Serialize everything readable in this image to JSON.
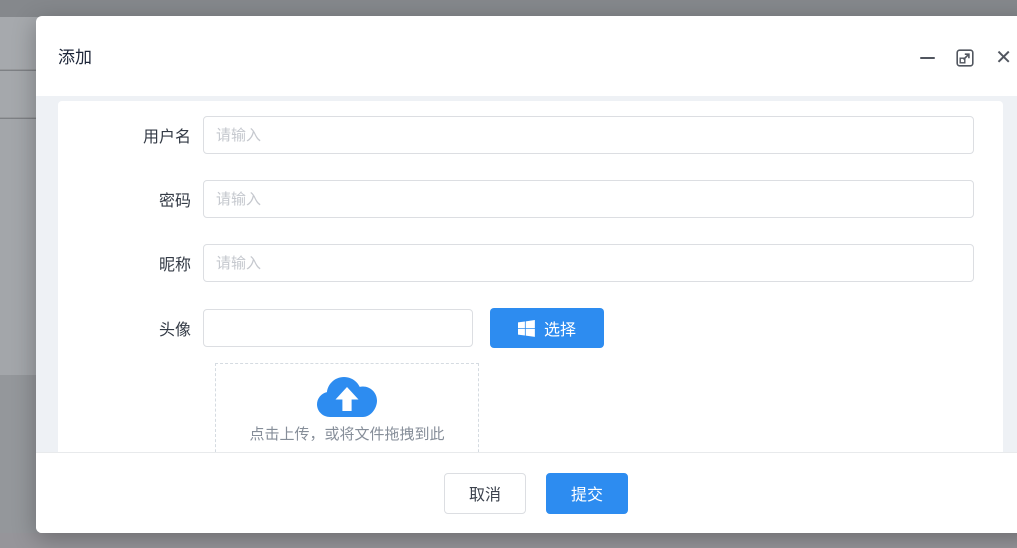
{
  "dialog": {
    "title": "添加",
    "controls": {
      "minimize_icon": "minimize-bar",
      "maximize_icon": "expand-arrow-square",
      "close_icon": "✕"
    }
  },
  "form": {
    "fields": [
      {
        "label": "用户名",
        "placeholder": "请输入",
        "value": ""
      },
      {
        "label": "密码",
        "placeholder": "请输入",
        "value": ""
      },
      {
        "label": "昵称",
        "placeholder": "请输入",
        "value": ""
      },
      {
        "label": "头像",
        "placeholder": "",
        "value": "",
        "button_label": "选择",
        "button_icon": "windows-logo"
      }
    ],
    "upload": {
      "icon": "cloud-upload",
      "text": "点击上传，或将文件拖拽到此"
    }
  },
  "footer": {
    "cancel_label": "取消",
    "submit_label": "提交"
  },
  "colors": {
    "primary": "#2d8cf0",
    "body_bg": "#eef1f5",
    "input_border": "#dcdee2",
    "placeholder": "#c5c8ce",
    "overlay_gray": "#a3a6aa"
  }
}
